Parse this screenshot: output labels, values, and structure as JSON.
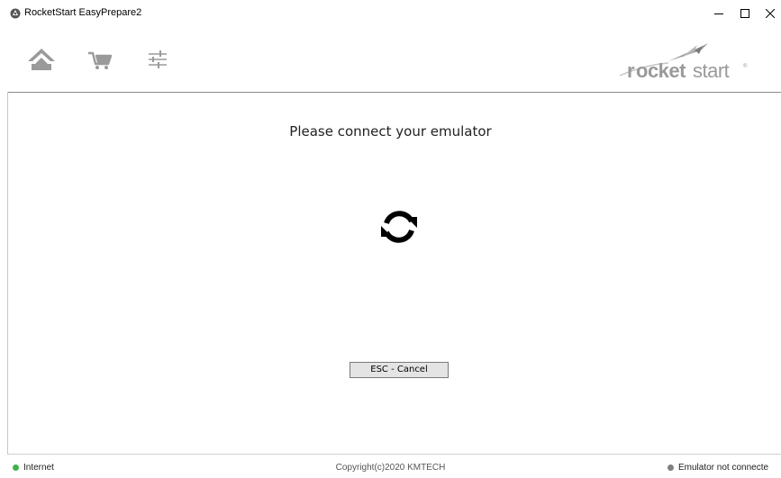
{
  "window": {
    "title": "RocketStart EasyPrepare2",
    "controls": {
      "minimize": "minimize-icon",
      "maximize": "maximize-icon",
      "close": "close-icon"
    }
  },
  "toolbar": {
    "icons": [
      "home-icon",
      "cart-icon",
      "settings-sliders-icon"
    ],
    "logo_text": "rocketstart"
  },
  "main": {
    "prompt": "Please connect your emulator",
    "status_icon": "sync-icon",
    "cancel_label": "ESC - Cancel"
  },
  "statusbar": {
    "internet_label": "Internet",
    "internet_color": "#3fb24a",
    "copyright": "Copyright(c)2020 KMTECH",
    "emulator_label": "Emulator not connecte",
    "emulator_color": "#808080"
  }
}
